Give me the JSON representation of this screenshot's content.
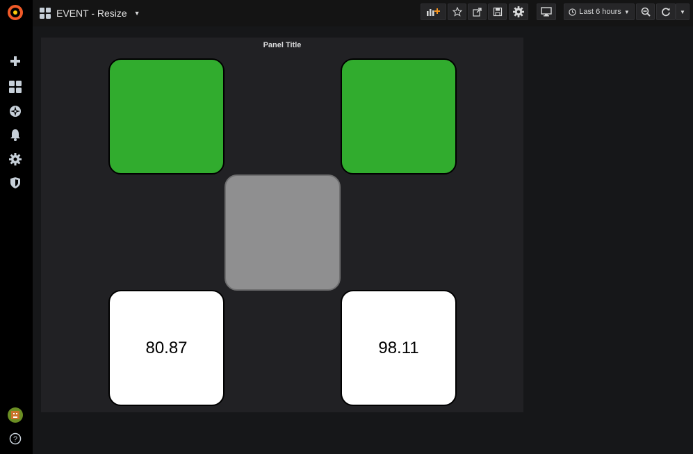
{
  "topbar": {
    "dashboard_title": "EVENT - Resize",
    "time_range_label": "Last 6 hours"
  },
  "sidebar": {
    "items": [
      "grafana-logo-icon",
      "plus-icon",
      "dashboards-icon",
      "explore-icon",
      "alerting-icon",
      "configuration-icon",
      "shield-icon"
    ],
    "bottom": [
      "avatar",
      "help-icon"
    ]
  },
  "panel": {
    "title": "Panel Title",
    "tiles": [
      {
        "color": "#31ac2e",
        "value": ""
      },
      {
        "color": "#31ac2e",
        "value": ""
      },
      {
        "color": "#8f8f90",
        "value": ""
      },
      {
        "color": "#ffffff",
        "value": "80.87"
      },
      {
        "color": "#ffffff",
        "value": "98.11"
      }
    ]
  },
  "colors": {
    "ok": "#31ac2e",
    "unknown": "#8f8f90",
    "no_threshold": "#ffffff",
    "grafana_orange": "#f05a28"
  }
}
